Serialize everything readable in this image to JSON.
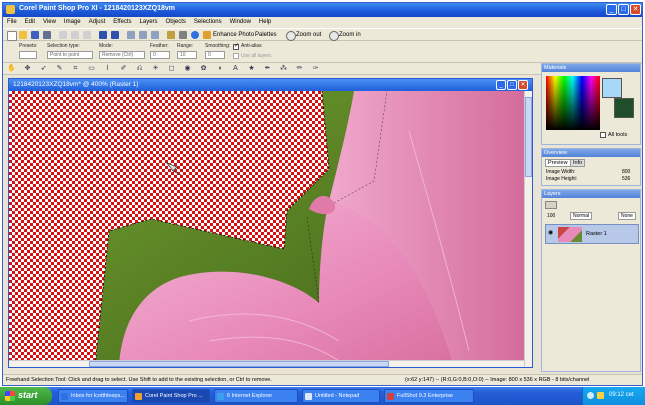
{
  "app": {
    "title": "Corel Paint Shop Pro XI - 1218420123XZQ18vm",
    "window_buttons": [
      "_",
      "□",
      "✕"
    ]
  },
  "menu": [
    "File",
    "Edit",
    "View",
    "Image",
    "Adjust",
    "Effects",
    "Layers",
    "Objects",
    "Selections",
    "Window",
    "Help"
  ],
  "toolbar": {
    "enhance_photo": "Enhance Photo",
    "palettes": "Palettes",
    "zoom_out": "Zoom out",
    "zoom_in": "Zoom in"
  },
  "tool_options": {
    "presets_label": "Presets:",
    "selection_type_label": "Selection type:",
    "selection_type_value": "Point to point",
    "mode_label": "Mode:",
    "mode_value": "Remove (Ctrl)",
    "feather_label": "Feather:",
    "feather_value": "0",
    "range_label": "Range:",
    "range_value": "10",
    "smoothing_label": "Smoothing:",
    "smoothing_value": "0",
    "antialias_label": "Anti-alias",
    "antialias_checked": true,
    "use_all_layers_label": "Use all layers",
    "use_all_layers_checked": false
  },
  "document": {
    "title": "1218420123XZQ18vm* @ 400% (Raster 1)"
  },
  "materials": {
    "title": "Materials",
    "all_tools_label": "All tools",
    "foreground_color": "#1e4e2a",
    "background_color": "#a8d8f8"
  },
  "overview": {
    "title": "Overview",
    "tabs": [
      "Preview",
      "Info"
    ],
    "image_width_label": "Image Width:",
    "image_width_value": "800",
    "image_height_label": "Image Height:",
    "image_height_value": "536"
  },
  "layers": {
    "title": "Layers",
    "opacity": "100",
    "blend_mode": "Normal",
    "lock": "None",
    "items": [
      {
        "name": "Raster 1"
      }
    ]
  },
  "status": {
    "hint": "Freehand Selection Tool: Click and drag to select. Use Shift to add to the existing selection, or Ctrl to remove.",
    "coords": "(x:62 y:147) -- (R:0,G:0,B:0,O:0) -- Image: 800 x 536 x RGB - 8 bits/channel"
  },
  "taskbar": {
    "start_label": "start",
    "tasks": [
      {
        "label": "Inbox for lcotthleeps...",
        "color": "#2e70e0",
        "active": false
      },
      {
        "label": "Corel Paint Shop Pro ...",
        "color": "#f0a030",
        "active": true
      },
      {
        "label": "6 Internet Explorer",
        "color": "#3aa0f0",
        "active": false
      },
      {
        "label": "Untitled - Notepad",
        "color": "#dfe8f8",
        "active": false
      },
      {
        "label": "FullShot 9.3 Enterprise",
        "color": "#d04040",
        "active": false
      }
    ],
    "clock": "09:12 cet"
  },
  "colors": {
    "checker_red": "#d41010",
    "petal_pink": "#e88aba",
    "leaf_green": "#4e7a1e",
    "xp_blue": "#245ed8"
  }
}
